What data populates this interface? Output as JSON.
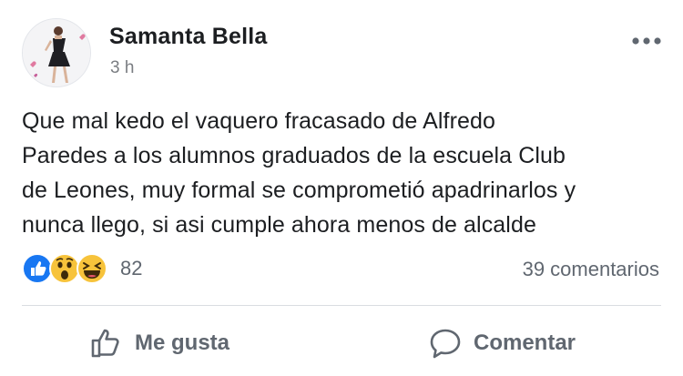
{
  "post": {
    "author": "Samanta Bella",
    "time": "3 h",
    "text": "Que mal kedo el vaquero fracasado de Alfredo\nParedes a los alumnos graduados de la escuela Club\nde Leones, muy formal se comprometió apadrinarlos y\nnunca llego, si asi cumple ahora menos de alcalde"
  },
  "reactions": {
    "types": [
      "like-icon",
      "wow-icon",
      "haha-icon"
    ],
    "count": "82"
  },
  "comments": {
    "count_label": "39 comentarios"
  },
  "actions": {
    "like_label": "Me gusta",
    "comment_label": "Comentar"
  },
  "colors": {
    "text": "#1c1e21",
    "secondary": "#606770",
    "like_blue": "#1877f2",
    "emoji_yellow": "#f7c33b",
    "divider": "#dadde1"
  }
}
